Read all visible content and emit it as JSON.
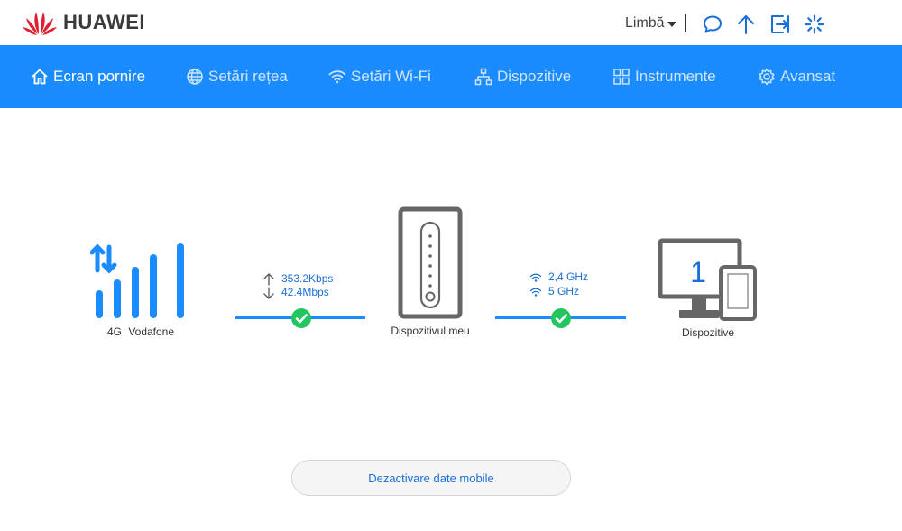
{
  "brand": {
    "name": "HUAWEI",
    "color": "#e0202f"
  },
  "header": {
    "language_label": "Limbă",
    "icons": [
      "message-icon",
      "update-arrow-icon",
      "logout-icon",
      "loading-spinner-icon"
    ]
  },
  "nav": {
    "items": [
      {
        "label": "Ecran pornire",
        "icon": "home-icon",
        "active": true
      },
      {
        "label": "Setări rețea",
        "icon": "globe-icon",
        "active": false
      },
      {
        "label": "Setări Wi-Fi",
        "icon": "wifi-icon",
        "active": false
      },
      {
        "label": "Dispozitive",
        "icon": "network-icon",
        "active": false
      },
      {
        "label": "Instrumente",
        "icon": "grid-icon",
        "active": false
      },
      {
        "label": "Avansat",
        "icon": "gear-icon",
        "active": false
      }
    ]
  },
  "network": {
    "type": "4G",
    "operator": "Vodafone",
    "upload": "353.2Kbps",
    "download": "42.4Mbps",
    "connected": true
  },
  "router": {
    "label": "Dispozitivul meu"
  },
  "wifi": {
    "band1": "2,4 GHz",
    "band2": "5 GHz",
    "connected": true
  },
  "devices": {
    "count": "1",
    "label": "Dispozitive"
  },
  "actions": {
    "mobile_data_button": "Dezactivare date mobile"
  },
  "colors": {
    "accent": "#1a8cff",
    "link": "#1a6fd6",
    "ok": "#22c55e",
    "device_gray": "#666666"
  }
}
